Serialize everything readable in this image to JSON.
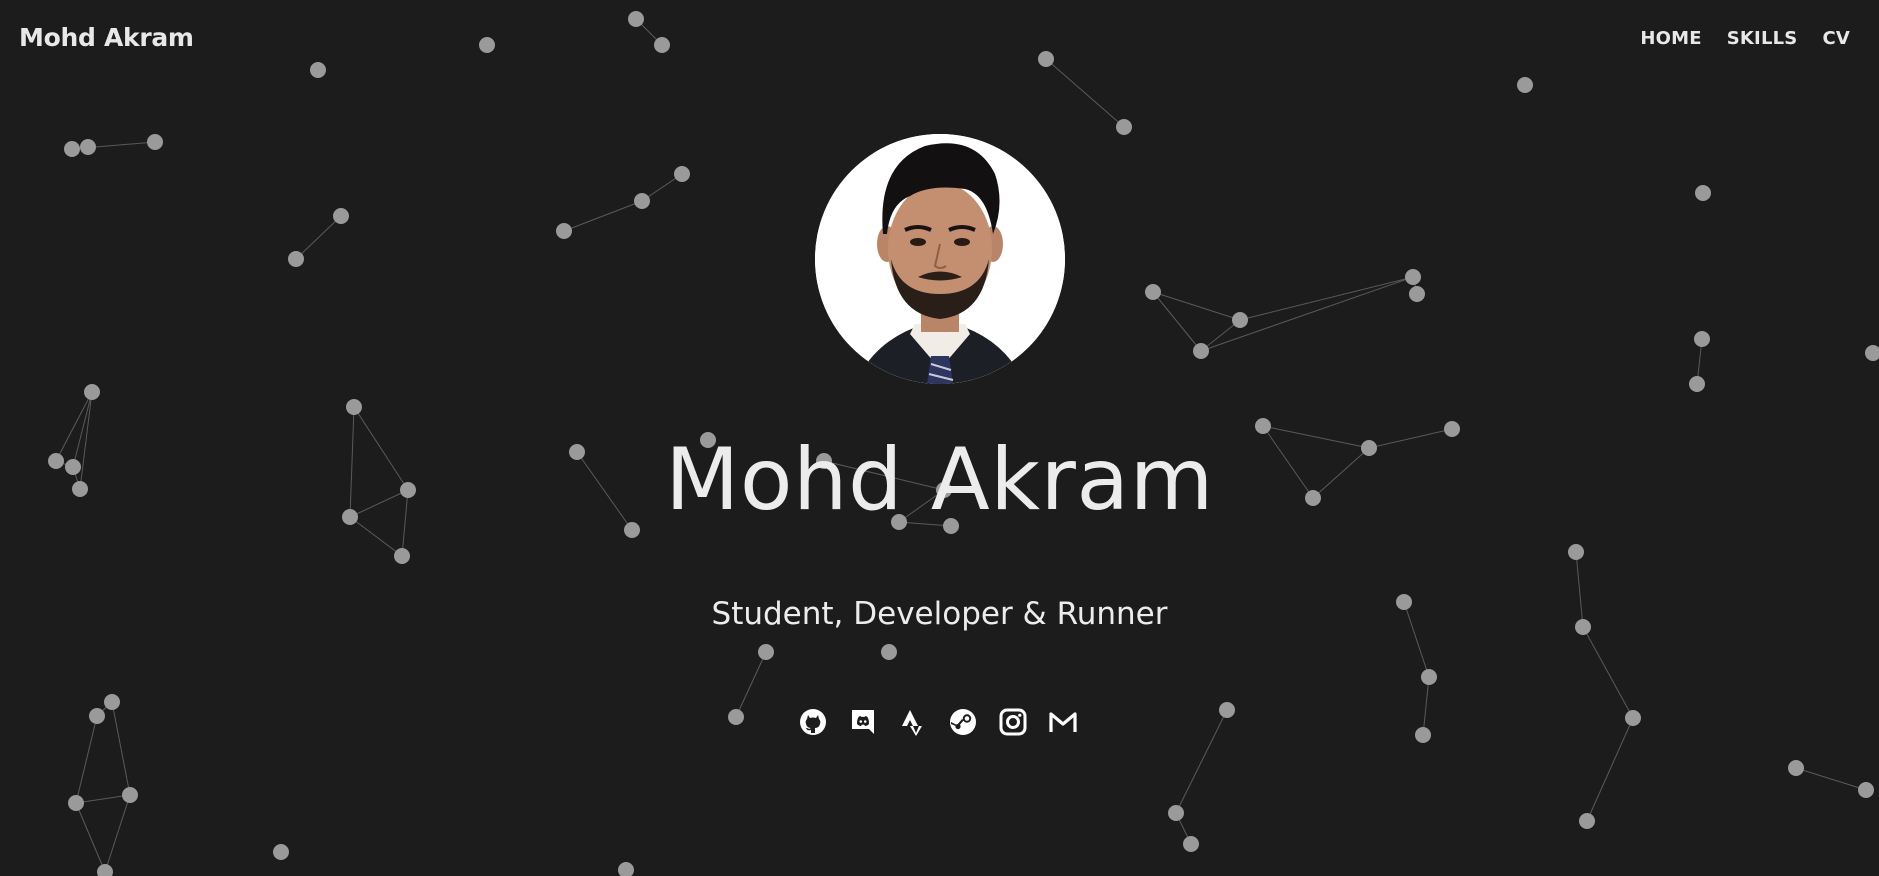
{
  "header": {
    "brand": "Mohd Akram",
    "nav": [
      {
        "label": "HOME"
      },
      {
        "label": "SKILLS"
      },
      {
        "label": "CV"
      }
    ]
  },
  "hero": {
    "name": "Mohd Akram",
    "tagline": "Student, Developer & Runner",
    "avatar_icon": "profile-photo"
  },
  "socials": [
    {
      "icon": "github-icon"
    },
    {
      "icon": "discord-icon"
    },
    {
      "icon": "strava-icon"
    },
    {
      "icon": "steam-icon"
    },
    {
      "icon": "instagram-icon"
    },
    {
      "icon": "gmail-icon"
    }
  ],
  "colors": {
    "background": "#1c1c1c",
    "text": "#ececec",
    "particle": "#9a9a9a"
  }
}
